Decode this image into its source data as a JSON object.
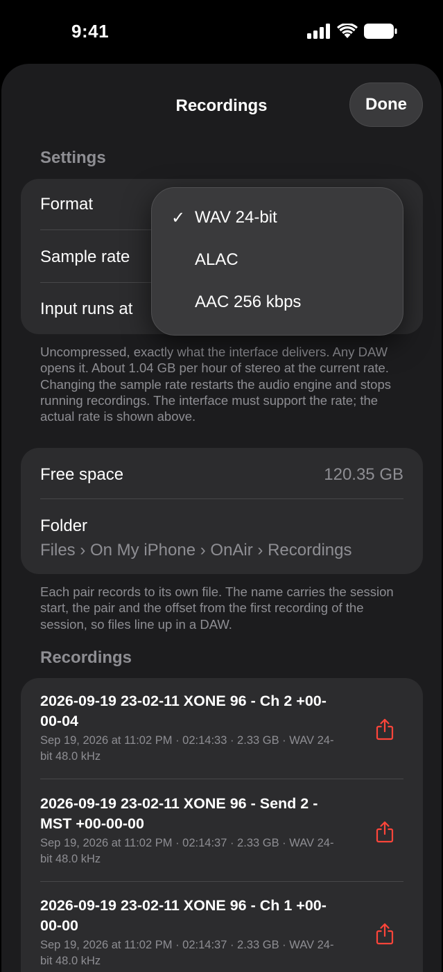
{
  "status": {
    "time": "9:41"
  },
  "sheet": {
    "title": "Recordings",
    "done_label": "Done"
  },
  "settings": {
    "header": "Settings",
    "rows": [
      {
        "label": "Format"
      },
      {
        "label": "Sample rate"
      },
      {
        "label": "Input runs at"
      }
    ],
    "footnote": "Uncompressed, exactly what the interface delivers. Any DAW opens it. About 1.04 GB per hour of stereo at the current rate. Changing the sample rate restarts the audio engine and stops running recordings. The interface must support the rate; the actual rate is shown above."
  },
  "format_menu": {
    "selected_index": 0,
    "check": "✓",
    "options": [
      "WAV 24-bit",
      "ALAC",
      "AAC 256 kbps"
    ]
  },
  "storage": {
    "free_space_label": "Free space",
    "free_space_value": "120.35 GB",
    "folder_label": "Folder",
    "folder_path": "Files › On My iPhone › OnAir › Recordings",
    "footnote": "Each pair records to its own file. The name carries the session start, the pair and the offset from the first recording of the session, so files line up in a DAW."
  },
  "recordings": {
    "header": "Recordings",
    "items": [
      {
        "title": "2026-09-19 23-02-11 XONE 96 - Ch 2 +00-00-04",
        "meta": "Sep 19, 2026 at 11:02 PM · 02:14:33 · 2.33 GB · WAV 24-bit 48.0 kHz"
      },
      {
        "title": "2026-09-19 23-02-11 XONE 96 - Send 2 - MST +00-00-00",
        "meta": "Sep 19, 2026 at 11:02 PM · 02:14:37 · 2.33 GB · WAV 24-bit 48.0 kHz"
      },
      {
        "title": "2026-09-19 23-02-11 XONE 96 - Ch 1 +00-00-00",
        "meta": "Sep 19, 2026 at 11:02 PM · 02:14:37 · 2.33 GB · WAV 24-bit 48.0 kHz"
      }
    ]
  },
  "colors": {
    "accent_share": "#ff453a",
    "sheet_bg": "#1c1c1e",
    "group_bg": "#2c2c2e"
  },
  "icons": [
    "cellular-signal-icon",
    "wifi-icon",
    "battery-icon",
    "checkmark-icon",
    "share-icon"
  ]
}
